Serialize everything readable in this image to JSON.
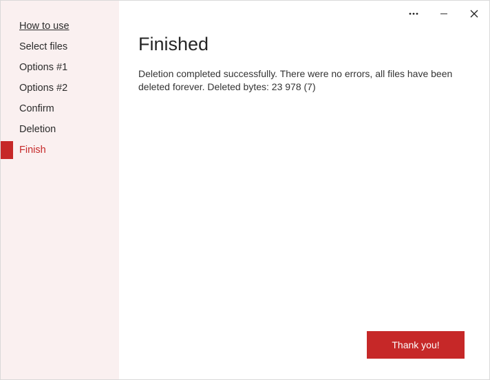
{
  "sidebar": {
    "items": [
      {
        "label": "How to use",
        "underlined": true
      },
      {
        "label": "Select files"
      },
      {
        "label": "Options #1"
      },
      {
        "label": "Options #2"
      },
      {
        "label": "Confirm"
      },
      {
        "label": "Deletion"
      },
      {
        "label": "Finish",
        "active": true
      }
    ]
  },
  "main": {
    "title": "Finished",
    "body": "Deletion completed successfully. There were no errors, all files have been deleted forever. Deleted bytes: 23 978 (7)"
  },
  "actions": {
    "primary_label": "Thank you!"
  }
}
